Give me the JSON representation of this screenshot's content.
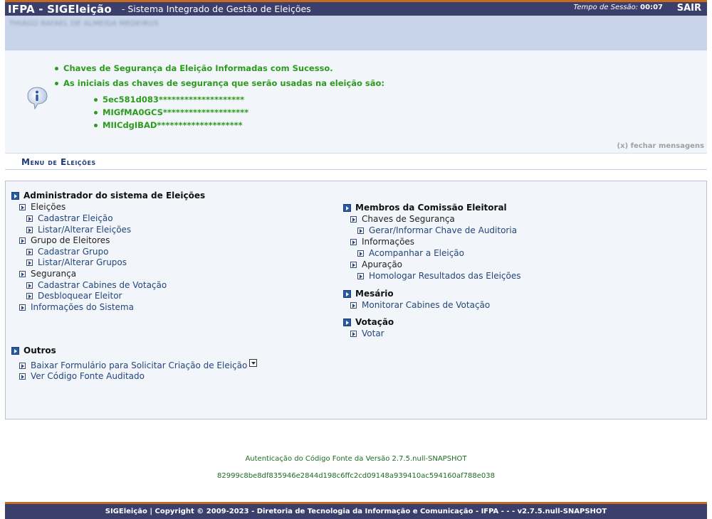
{
  "header": {
    "app_name": "IFPA - SIGEleição",
    "app_subtitle": "- Sistema Integrado de Gestão de Eleições",
    "session_label": "Tempo de Sessão:",
    "session_time": "00:07",
    "logout_label": "SAIR",
    "colors": {
      "bar": "#3a3f6b",
      "accent": "#c9691f"
    }
  },
  "user": {
    "name": "THIAGO RAFAEL DE ALMEIDA MEDEIROS"
  },
  "messages": {
    "items": [
      "Chaves de Segurança da Eleição Informadas com Sucesso.",
      "As iniciais das chaves de segurança que serão usadas na eleição são:"
    ],
    "keys": [
      "5ec581d083********************",
      "MIGfMA0GCS********************",
      "MIICdgIBAD********************"
    ],
    "close_label": "(x) fechar mensagens",
    "icon": "info-icon",
    "color": "#2c9b1d"
  },
  "menu": {
    "title": "Menu de Eleições",
    "admin": {
      "title": "Administrador do sistema de Eleições",
      "eleicoes": "Eleições",
      "cadastrar_eleicao": "Cadastrar Eleição",
      "listar_eleicoes": "Listar/Alterar Eleições",
      "grupo": "Grupo de Eleitores",
      "cadastrar_grupo": "Cadastrar Grupo",
      "listar_grupos": "Listar/Alterar Grupos",
      "seguranca": "Segurança",
      "cadastrar_cabines": "Cadastrar Cabines de Votação",
      "desbloquear": "Desbloquear Eleitor",
      "informacoes_sistema": "Informações do Sistema"
    },
    "comissao": {
      "title": "Membros da Comissão Eleitoral",
      "chaves": "Chaves de Segurança",
      "gerar_chave": "Gerar/Informar Chave de Auditoria",
      "informacoes": "Informações",
      "acompanhar": "Acompanhar a Eleição",
      "apuracao": "Apuração",
      "homologar": "Homologar Resultados das Eleições"
    },
    "mesario": {
      "title": "Mesário",
      "monitorar": "Monitorar Cabines de Votação"
    },
    "votacao": {
      "title": "Votação",
      "votar": "Votar"
    },
    "outros": {
      "title": "Outros",
      "baixar": "Baixar Formulário para Solicitar Criação de Eleição",
      "codigo_fonte": "Ver Código Fonte Auditado"
    }
  },
  "footer": {
    "auth_line": "Autenticação do Código Fonte da Versão 2.7.5.null-SNAPSHOT",
    "hash": "82999c8be8df835946e2844d198c6ffc2cd09148a939410ac594160af788e038",
    "copyright": "SIGEleição | Copyright © 2009-2023 - Diretoria de Tecnologia da Informação e Comunicação - IFPA - - - v2.7.5.null-SNAPSHOT"
  }
}
